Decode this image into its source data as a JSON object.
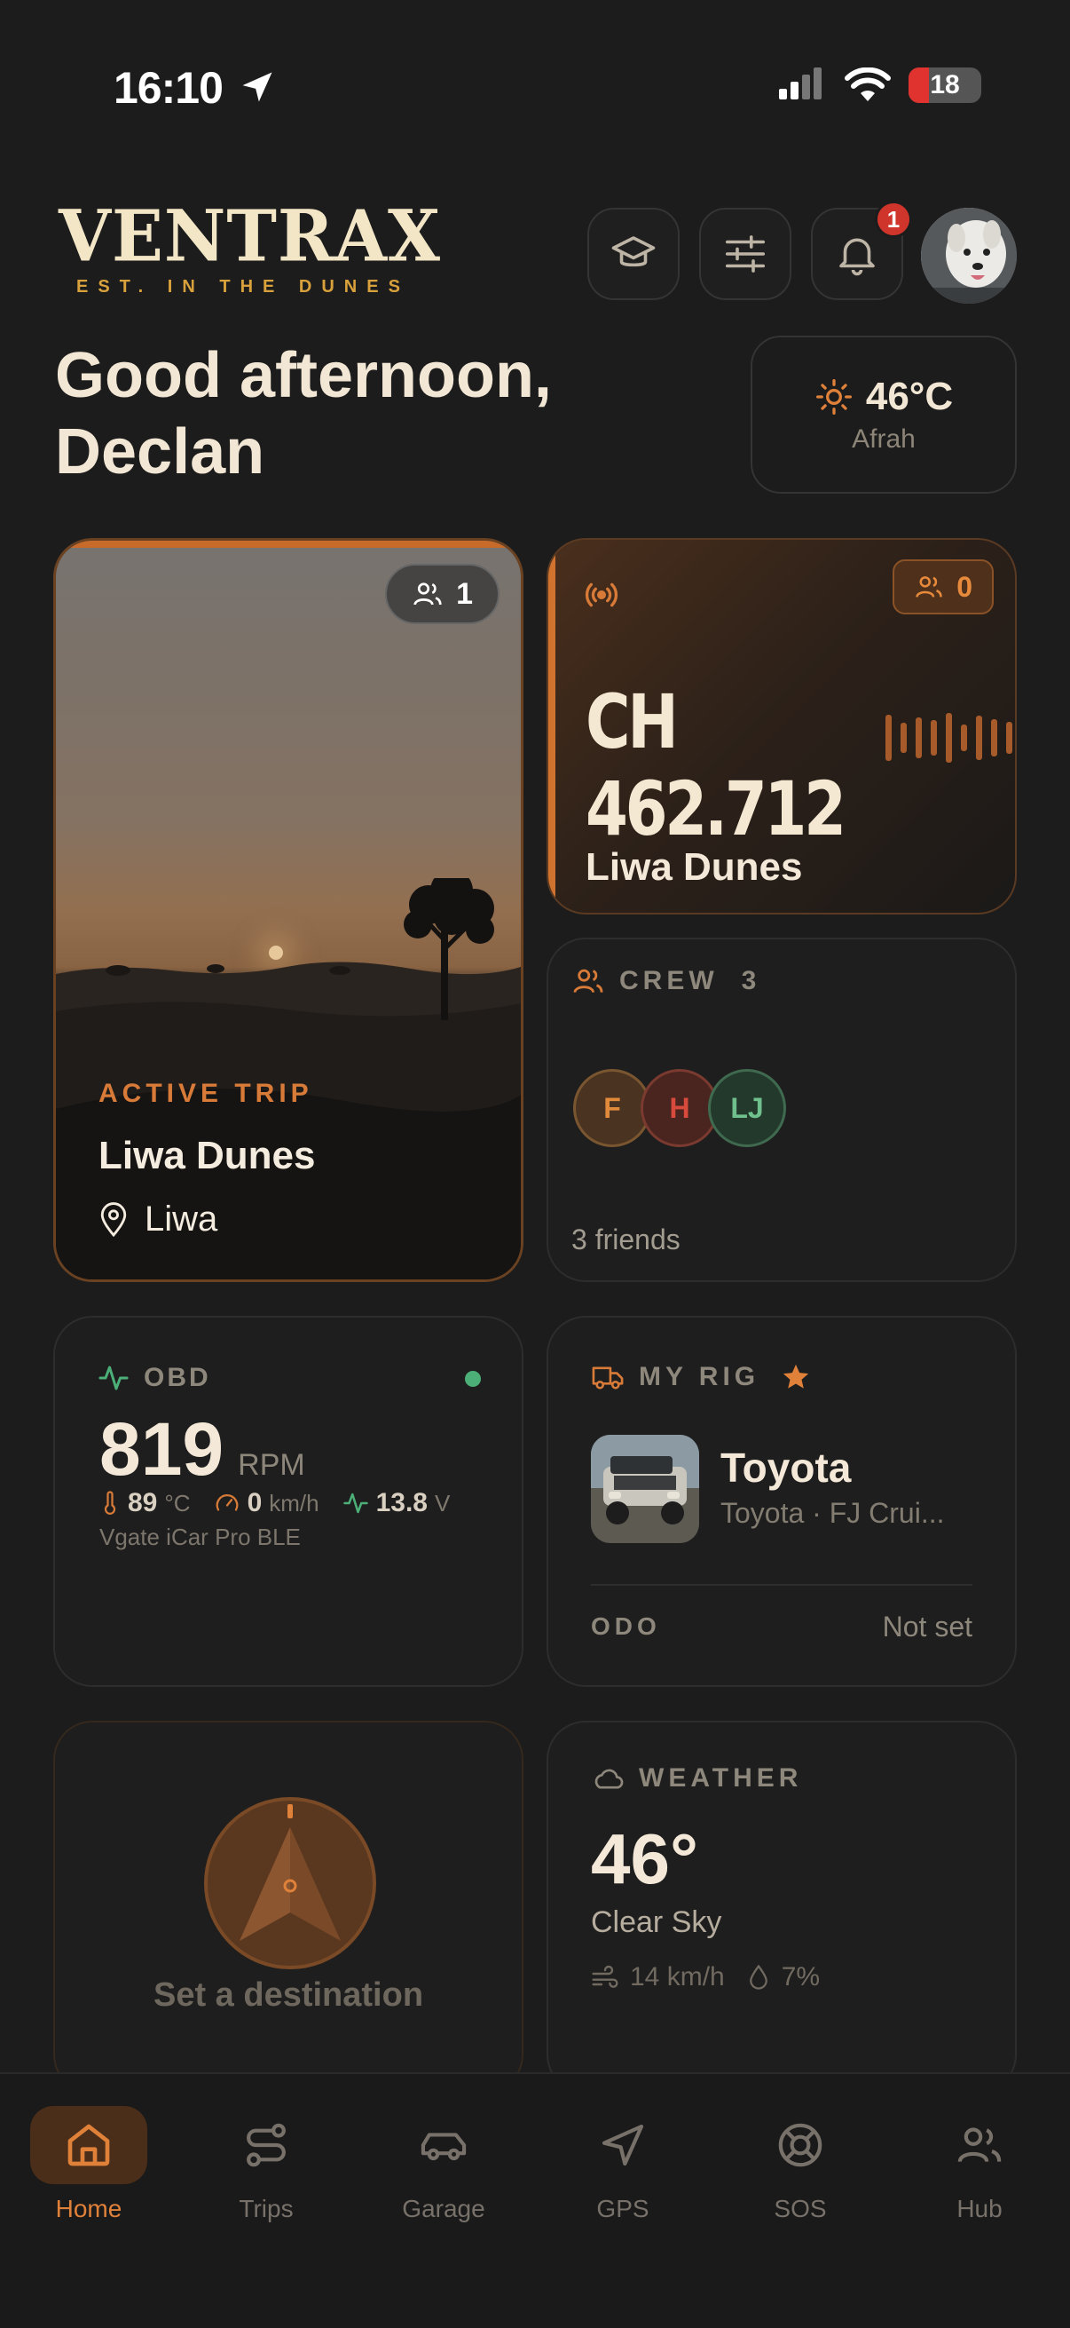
{
  "status_bar": {
    "time": "16:10",
    "battery": "18"
  },
  "brand": {
    "name": "VENTRAX",
    "tagline": "EST. IN THE DUNES"
  },
  "header": {
    "notification_count": "1"
  },
  "greeting": {
    "line1": "Good afternoon,",
    "line2": "Declan"
  },
  "weather_chip": {
    "temp": "46°C",
    "location": "Afrah"
  },
  "active_trip": {
    "label": "ACTIVE TRIP",
    "title": "Liwa Dunes",
    "location": "Liwa",
    "participants": "1"
  },
  "channel": {
    "frequency": "CH 462.712",
    "name": "Liwa Dunes",
    "listeners": "0"
  },
  "crew": {
    "label": "CREW",
    "count": "3",
    "members": [
      "F",
      "H",
      "LJ"
    ],
    "friends_text": "3 friends"
  },
  "obd": {
    "label": "OBD",
    "rpm": "819",
    "rpm_unit": "RPM",
    "coolant": "89",
    "coolant_unit": "°C",
    "speed": "0",
    "speed_unit": "km/h",
    "voltage": "13.8",
    "voltage_unit": "V",
    "device": "Vgate iCar Pro BLE"
  },
  "rig": {
    "label": "MY RIG",
    "make": "Toyota",
    "model": "Toyota · FJ Crui...",
    "odo_label": "ODO",
    "odo_value": "Not set"
  },
  "destination": {
    "text": "Set a destination"
  },
  "weather": {
    "label": "WEATHER",
    "temp": "46°",
    "condition": "Clear Sky",
    "wind": "14 km/h",
    "humidity": "7%"
  },
  "nav": {
    "home": "Home",
    "trips": "Trips",
    "garage": "Garage",
    "gps": "GPS",
    "sos": "SOS",
    "hub": "Hub"
  },
  "colors": {
    "accent": "#e0813a",
    "background": "#1c1c1c",
    "card": "#1e1e1e",
    "online": "#4caf78",
    "badge": "#d0352c"
  }
}
